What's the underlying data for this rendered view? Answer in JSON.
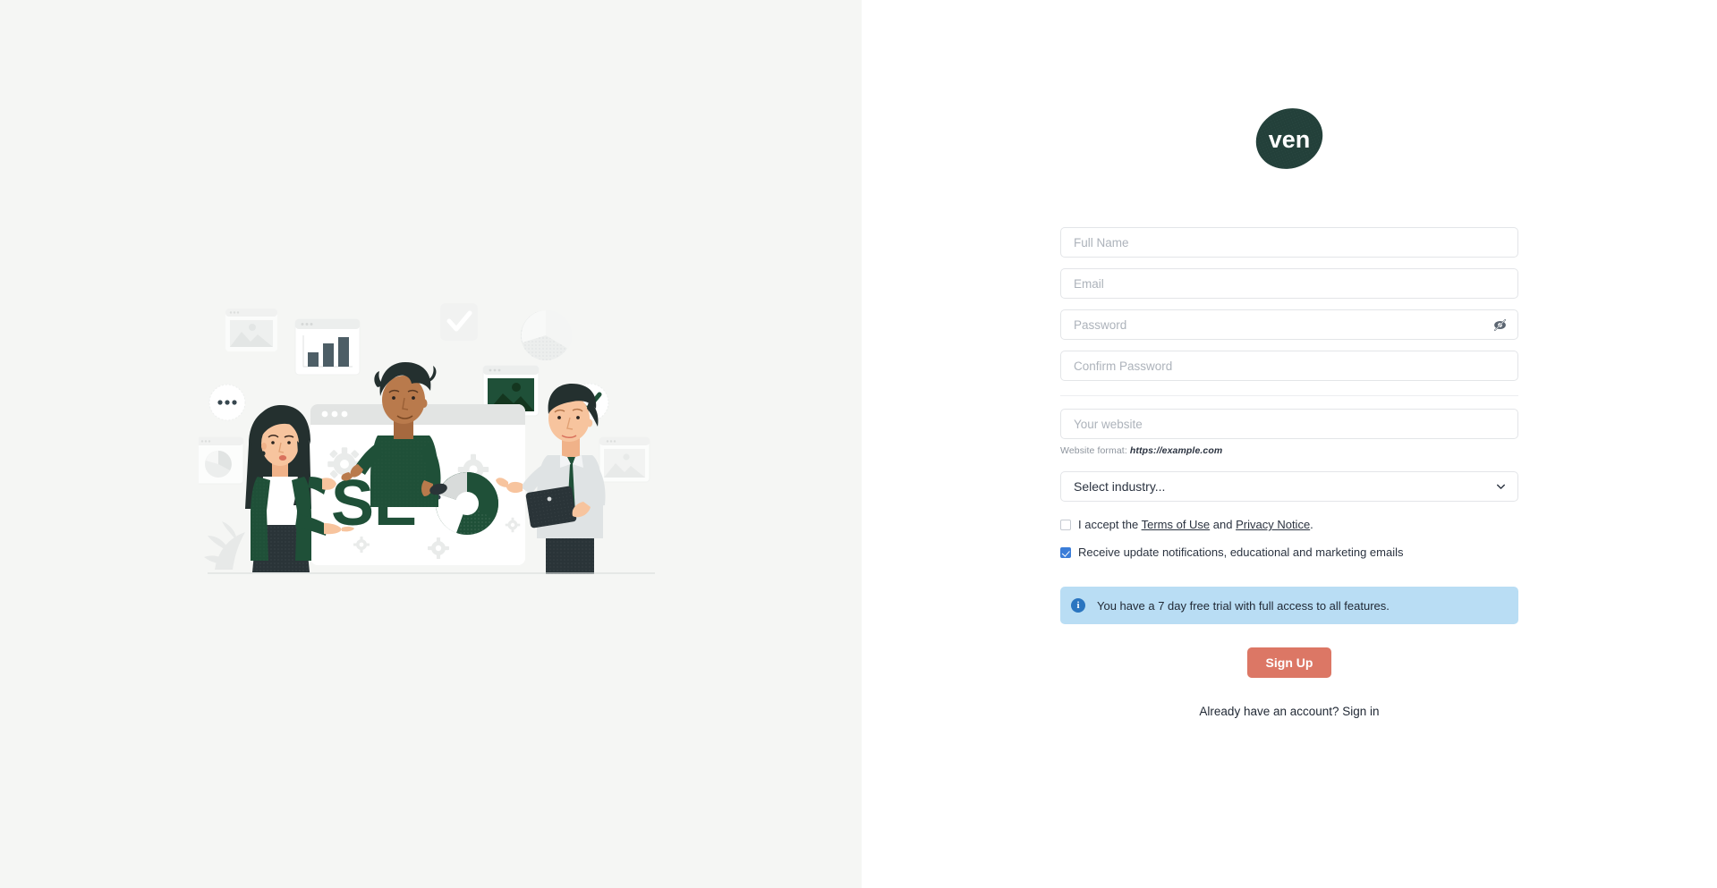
{
  "brand": {
    "logo_text": "ven",
    "logo_color": "#23403a",
    "logo_text_color": "#ffffff"
  },
  "colors": {
    "left_panel_bg": "#f5f6f4",
    "right_panel_bg": "#ffffff",
    "accent_button": "#dc7765",
    "checkbox_checked": "#3b7dd8",
    "info_banner_bg": "#b9ddf4",
    "info_icon_bg": "#2a75c0",
    "illustration_green": "#1f5038",
    "field_border": "#e3e5e8",
    "placeholder": "#adb3bb",
    "text": "#2b3340"
  },
  "form": {
    "full_name": {
      "placeholder": "Full Name",
      "value": ""
    },
    "email": {
      "placeholder": "Email",
      "value": ""
    },
    "password": {
      "placeholder": "Password",
      "value": "",
      "toggle_icon": "eye-slash-icon",
      "visible": false
    },
    "confirm_password": {
      "placeholder": "Confirm Password",
      "value": ""
    },
    "website": {
      "placeholder": "Your website",
      "value": ""
    },
    "website_hint_label": "Website format:",
    "website_hint_example": "https://example.com",
    "industry": {
      "selected_label": "Select industry...",
      "chevron_icon": "chevron-down-icon"
    }
  },
  "consents": [
    {
      "name": "terms",
      "checked": false,
      "prefix": "I accept the ",
      "link1": "Terms of Use",
      "middle": " and ",
      "link2": "Privacy Notice",
      "suffix": "."
    },
    {
      "name": "marketing",
      "checked": true,
      "label": "Receive update notifications, educational and marketing emails"
    }
  ],
  "banner": {
    "icon": "info-circle-icon",
    "text": "You have a 7 day free trial with full access to all features."
  },
  "actions": {
    "submit_label": "Sign Up",
    "signin_text": "Already have an account? Sign in"
  },
  "illustration": {
    "name": "seo-teamwork-illustration",
    "headline_text": "SEO",
    "elements": [
      "browser-window-card",
      "bar-chart-card",
      "image-placeholder-card",
      "pie-chart",
      "checkmark-badge",
      "chat-bubble",
      "gear-icons",
      "magnifying-glass",
      "woman-pointing",
      "man-leaning",
      "man-with-tablet",
      "plant-silhouette"
    ]
  }
}
